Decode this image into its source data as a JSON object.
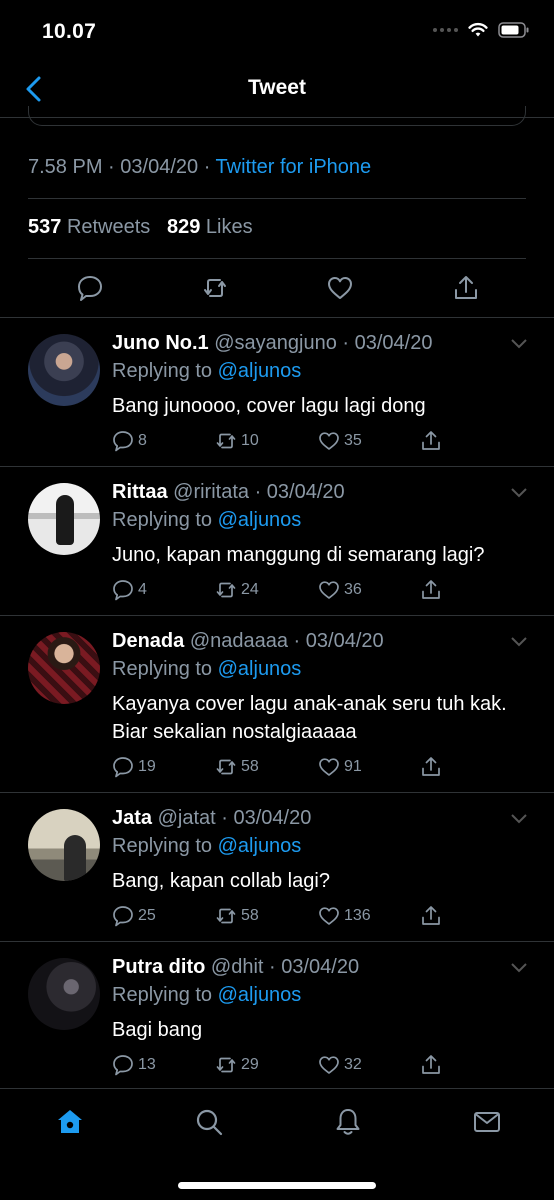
{
  "status_bar": {
    "time": "10.07"
  },
  "header": {
    "title": "Tweet"
  },
  "tweet": {
    "time": "7.58 PM",
    "date": "03/04/20",
    "source": "Twitter for iPhone",
    "retweets_count": "537",
    "retweets_label": "Retweets",
    "likes_count": "829",
    "likes_label": "Likes"
  },
  "replies": [
    {
      "name": "Juno No.1",
      "handle": "@sayangjuno",
      "date": "03/04/20",
      "replying_label": "Replying to",
      "mention": "@aljunos",
      "text": "Bang junoooo, cover lagu lagi dong",
      "reply_count": "8",
      "retweet_count": "10",
      "like_count": "35"
    },
    {
      "name": "Rittaa",
      "handle": "@riritata",
      "date": "03/04/20",
      "replying_label": "Replying to",
      "mention": "@aljunos",
      "text": "Juno, kapan manggung di semarang lagi?",
      "reply_count": "4",
      "retweet_count": "24",
      "like_count": "36"
    },
    {
      "name": "Denada",
      "handle": "@nadaaaa",
      "date": "03/04/20",
      "replying_label": "Replying to",
      "mention": "@aljunos",
      "text": "Kayanya cover lagu anak-anak seru tuh kak. Biar sekalian nostalgiaaaaa",
      "reply_count": "19",
      "retweet_count": "58",
      "like_count": "91"
    },
    {
      "name": "Jata",
      "handle": "@jatat",
      "date": "03/04/20",
      "replying_label": "Replying to",
      "mention": "@aljunos",
      "text": "Bang, kapan collab lagi?",
      "reply_count": "25",
      "retweet_count": "58",
      "like_count": "136"
    },
    {
      "name": "Putra dito",
      "handle": "@dhit",
      "date": "03/04/20",
      "replying_label": "Replying to",
      "mention": "@aljunos",
      "text": "Bagi bang",
      "reply_count": "13",
      "retweet_count": "29",
      "like_count": "32"
    }
  ],
  "colors": {
    "accent": "#1d9bf0",
    "muted": "#8b98a5",
    "border": "#2f3336",
    "background": "#000000"
  },
  "tab_bar": {
    "icons": [
      "home-icon",
      "search-icon",
      "notifications-icon",
      "messages-icon"
    ],
    "active": "home-icon"
  }
}
